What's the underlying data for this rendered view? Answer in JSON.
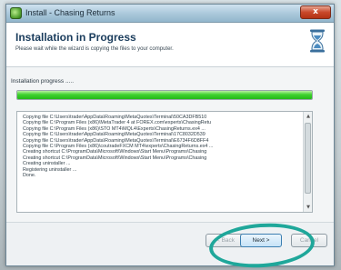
{
  "window": {
    "title": "Install - Chasing Returns",
    "close_label": "x"
  },
  "header": {
    "title": "Installation in Progress",
    "subtitle": "Please wait while the wizard is copying the files to your computer.",
    "icon": "hourglass-icon"
  },
  "progress": {
    "label": "Installation progress .....",
    "fraction": 1.0
  },
  "log": {
    "lines": [
      "Copying file C:\\Users\\trader\\AppData\\Roaming\\MetaQuotes\\Terminal\\50CA3DFB510",
      "Copying file C:\\Program Files (x86)\\MetaTrader 4 at FOREX.com\\experts\\ChasingRetu",
      "Copying file C:\\Program Files (x86)\\STO MT4\\MQL4\\Experts\\ChasingReturns.ex4 ...",
      "Copying file C:\\Users\\trader\\AppData\\Roaming\\MetaQuotes\\Terminal\\17C8032D539",
      "Copying file C:\\Users\\trader\\AppData\\Roaming\\MetaQuotes\\Terminal\\E6734F6D8FF4",
      "Copying file C:\\Program Files (x86)\\coutradeFXCM MT4\\experts\\ChasingReturns.ex4 ...",
      "Creating shortcut C:\\ProgramData\\Microsoft\\Windows\\Start Menu\\Programs\\Chasing",
      "Creating shortcut C:\\ProgramData\\Microsoft\\Windows\\Start Menu\\Programs\\Chasing",
      "Creating uninstaller ...",
      "Registering uninstaller ...",
      "Done."
    ]
  },
  "buttons": {
    "back": "< Back",
    "next": "Next >",
    "cancel": "Cancel"
  }
}
